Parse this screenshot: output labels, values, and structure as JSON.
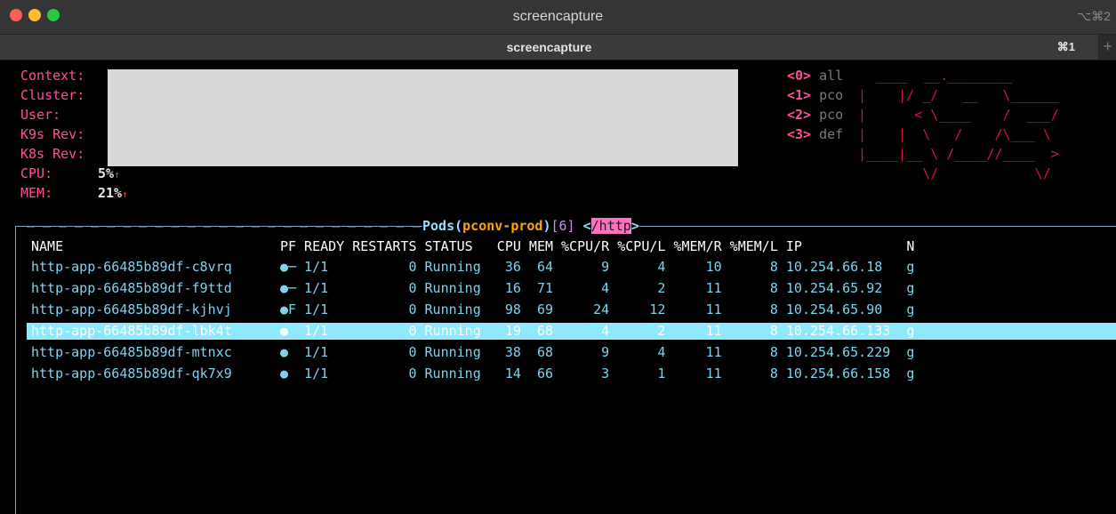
{
  "window": {
    "title": "screencapture",
    "shortcut": "⌥⌘2"
  },
  "tab": {
    "title": "screencapture",
    "shortcut": "⌘1",
    "new_tab": "+"
  },
  "info": {
    "labels": [
      "Context:",
      "Cluster:",
      "User:",
      "K9s Rev:",
      "K8s Rev:",
      "CPU:",
      "MEM:"
    ],
    "cpu": "5%",
    "mem": "21%",
    "trend": "↑"
  },
  "contexts": [
    {
      "key": "<0>",
      "name": "all"
    },
    {
      "key": "<1>",
      "name": "pco"
    },
    {
      "key": "<2>",
      "name": "pco"
    },
    {
      "key": "<3>",
      "name": "def"
    }
  ],
  "logo": [
    "____  __.________",
    "|    |/ _/   __   \\______",
    "|      < \\____    /  ___/",
    "|    |  \\   /    /\\___ \\",
    "|____|__ \\ /____//____  >",
    "        \\/            \\/"
  ],
  "panel": {
    "resource": "Pods",
    "namespace": "pconv-prod",
    "count": "[6]",
    "filter": "/http"
  },
  "table": {
    "header": "NAME                           PF READY RESTARTS STATUS   CPU MEM %CPU/R %CPU/L %MEM/R %MEM/L IP             N",
    "rows": [
      "http-app-66485b89df-c8vrq      ●─ 1/1          0 Running   36  64      9      4     10      8 10.254.66.18   g",
      "http-app-66485b89df-f9ttd      ●─ 1/1          0 Running   16  71      4      2     11      8 10.254.65.92   g",
      "http-app-66485b89df-kjhvj      ●F 1/1          0 Running   98  69     24     12     11      8 10.254.65.90   g",
      "http-app-66485b89df-lbk4t      ●  1/1          0 Running   19  68      4      2     11      8 10.254.66.133  g",
      "http-app-66485b89df-mtnxc      ●  1/1          0 Running   38  68      9      4     11      8 10.254.65.229  g",
      "http-app-66485b89df-qk7x9      ●  1/1          0 Running   14  66      3      1     11      8 10.254.66.158  g"
    ]
  },
  "colors": {
    "label": "#ff4f9b",
    "logo": "#d1173a",
    "row": "#7dd3ec",
    "selection": "#8ee8ff",
    "namespace": "#ffa500",
    "filter_bg": "#ff70c0"
  }
}
